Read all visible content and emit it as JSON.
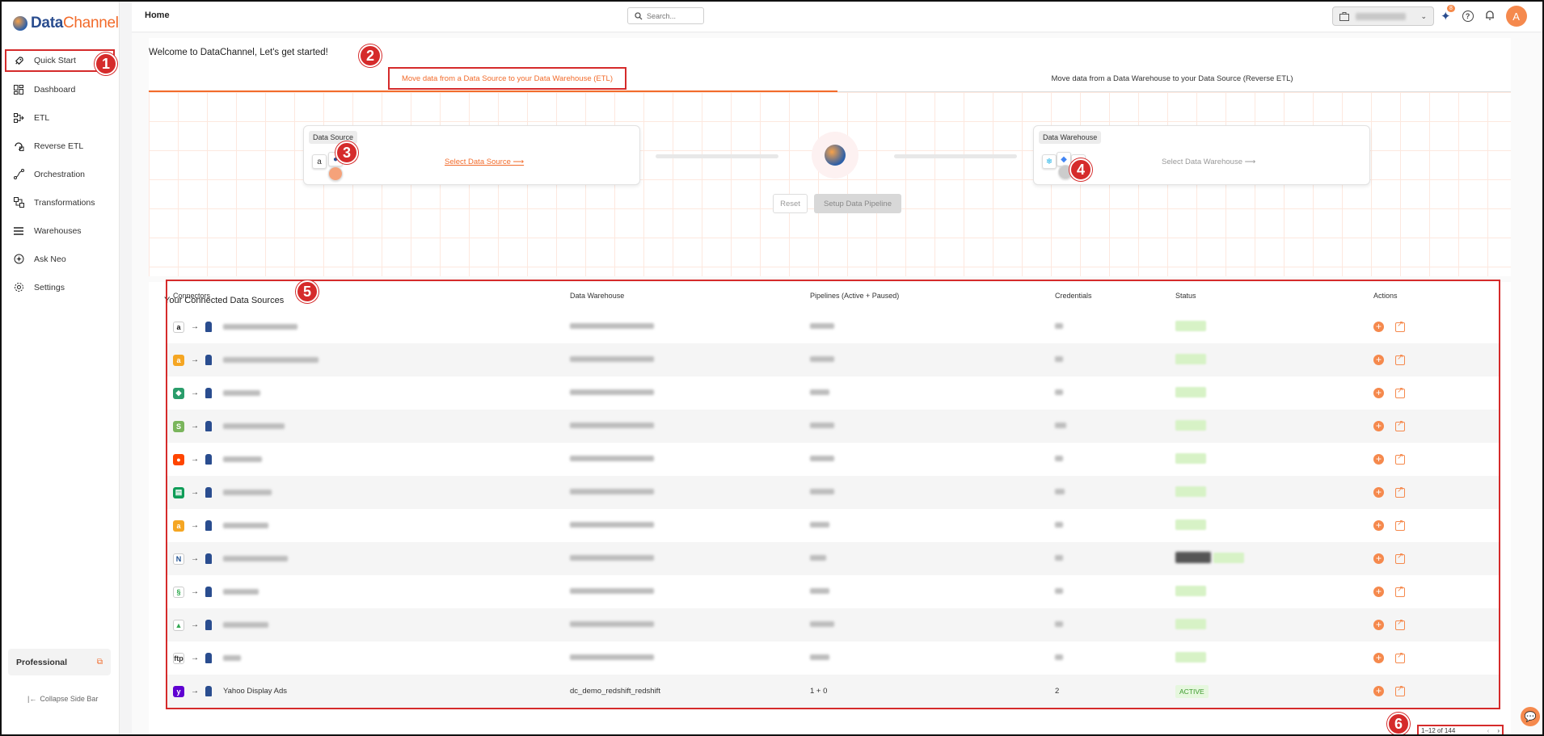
{
  "app": {
    "logo_part1": "Data",
    "logo_part2": "Channel"
  },
  "sidebar": {
    "items": [
      {
        "label": "Quick Start",
        "icon": "rocket-icon"
      },
      {
        "label": "Dashboard",
        "icon": "dashboard-icon"
      },
      {
        "label": "ETL",
        "icon": "etl-icon"
      },
      {
        "label": "Reverse ETL",
        "icon": "reverse-etl-icon"
      },
      {
        "label": "Orchestration",
        "icon": "orchestration-icon"
      },
      {
        "label": "Transformations",
        "icon": "transformations-icon"
      },
      {
        "label": "Warehouses",
        "icon": "list-icon"
      },
      {
        "label": "Ask Neo",
        "icon": "ask-neo-icon"
      },
      {
        "label": "Settings",
        "icon": "gear-icon"
      }
    ],
    "plan": "Professional",
    "collapse": "Collapse Side Bar"
  },
  "topbar": {
    "title": "Home",
    "search_placeholder": "Search...",
    "notification_badge": "8",
    "avatar_initial": "A"
  },
  "quickstart": {
    "welcome": "Welcome to DataChannel, Let's get started!",
    "tab_etl": "Move data from a Data Source to your Data Warehouse (ETL)",
    "tab_reverse": "Move data from a Data Warehouse to your Data Source (Reverse ETL)",
    "source_tag": "Data Source",
    "source_link": "Select Data Source ⟶",
    "warehouse_tag": "Data Warehouse",
    "warehouse_link": "Select Data Warehouse ⟶",
    "reset_button": "Reset",
    "setup_button": "Setup Data Pipeline"
  },
  "table": {
    "title": "Your Connected Data Sources",
    "headers": [
      "Connectors",
      "Data Warehouse",
      "Pipelines (Active + Paused)",
      "Credentials",
      "Status",
      "Actions"
    ],
    "last_row": {
      "connector": "Yahoo Display Ads",
      "warehouse": "dc_demo_redshift_redshift",
      "pipelines": "1 + 0",
      "credentials": "2",
      "status": "ACTIVE"
    },
    "row_icons": [
      "amazon",
      "amazon-orange",
      "green-shield",
      "shopify",
      "reddit",
      "google-sheets",
      "amazon-orange",
      "blue-logo",
      "green-swirl",
      "google-drive",
      "ftp",
      "yahoo"
    ]
  },
  "pagination": {
    "range": "1–12 of 144",
    "prev": "‹",
    "next": "›"
  },
  "markers": [
    "1",
    "2",
    "3",
    "4",
    "5",
    "6"
  ],
  "colors": {
    "accent": "#f26b2b",
    "brand_blue": "#2a4d8f",
    "highlight_red": "#d52b2b"
  }
}
